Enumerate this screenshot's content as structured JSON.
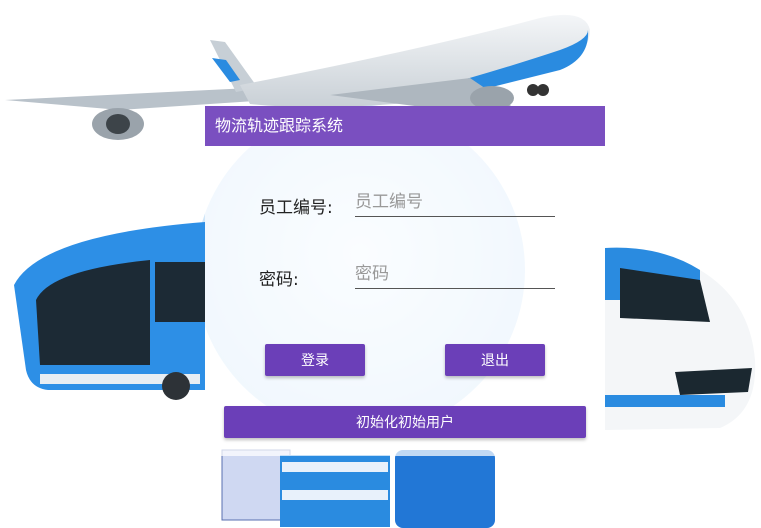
{
  "app": {
    "title": "物流轨迹跟踪系统"
  },
  "form": {
    "employee_id": {
      "label": "员工编号:",
      "placeholder": "员工编号",
      "value": ""
    },
    "password": {
      "label": "密码:",
      "placeholder": "密码",
      "value": ""
    }
  },
  "buttons": {
    "login": "登录",
    "exit": "退出",
    "init_user": "初始化初始用户"
  },
  "colors": {
    "accent": "#6b3fb8",
    "header": "#7a4fc0"
  }
}
